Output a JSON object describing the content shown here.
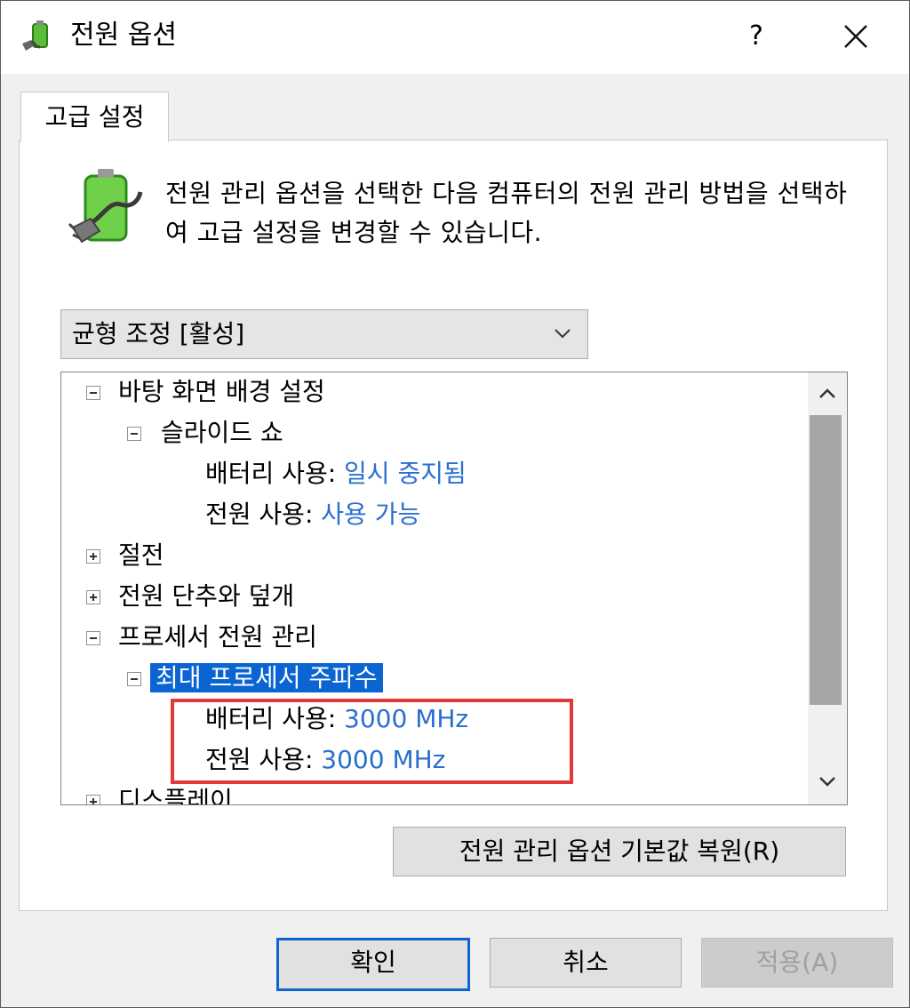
{
  "window": {
    "title": "전원 옵션",
    "help_label": "?"
  },
  "tab": {
    "label": "고급 설정"
  },
  "description": "전원 관리 옵션을 선택한 다음 컴퓨터의 전원 관리 방법을 선택하여 고급 설정을 변경할 수 있습니다.",
  "plan_select": {
    "selected": "균형 조정 [활성]"
  },
  "tree": {
    "desktop_background": "바탕 화면 배경 설정",
    "slideshow": "슬라이드 쇼",
    "slideshow_battery_label": "배터리 사용:",
    "slideshow_battery_value": "일시 중지됨",
    "slideshow_power_label": "전원 사용:",
    "slideshow_power_value": "사용 가능",
    "sleep": "절전",
    "power_buttons": "전원 단추와 덮개",
    "processor_power": "프로세서 전원 관리",
    "max_cpu_freq": "최대 프로세서 주파수",
    "cpu_battery_label": "배터리 사용:",
    "cpu_battery_value": "3000 MHz",
    "cpu_power_label": "전원 사용:",
    "cpu_power_value": "3000 MHz",
    "display": "디스플레이"
  },
  "buttons": {
    "restore_defaults": "전원 관리 옵션 기본값 복원(R)",
    "ok": "확인",
    "cancel": "취소",
    "apply": "적용(A)"
  },
  "colors": {
    "selection": "#0a64d2",
    "value_link": "#2a6fd0",
    "highlight_box": "#e2393b"
  },
  "icons": [
    "power-plug-icon",
    "battery-plug-icon",
    "close-icon",
    "chevron-down-icon",
    "scroll-up-icon",
    "scroll-down-icon"
  ]
}
